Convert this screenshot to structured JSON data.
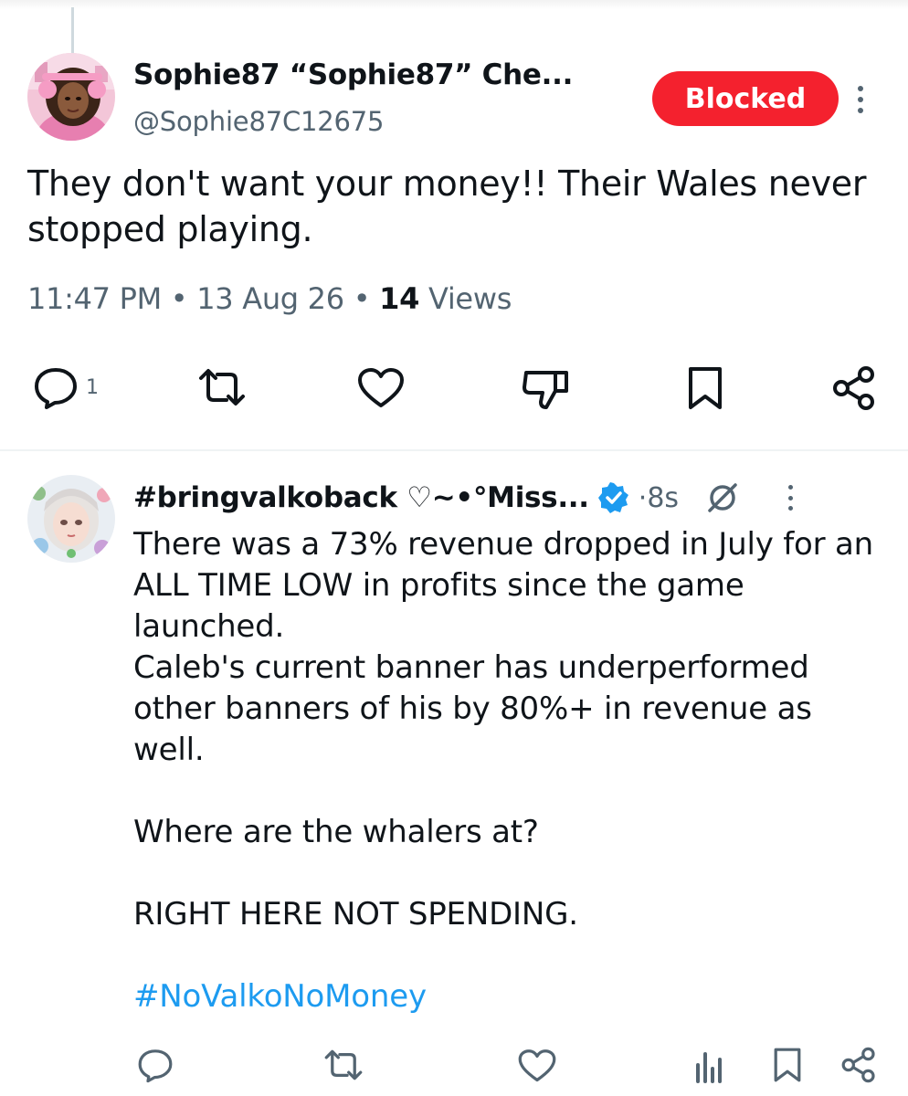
{
  "focused_tweet": {
    "display_name": "Sophie87 “Sophie87” Che...",
    "handle": "@Sophie87C12675",
    "block_button_label": "Blocked",
    "text": "They don't want your money!! Their Wales never stopped playing.",
    "time": "11:47 PM",
    "date": "13 Aug 26",
    "separator": "•",
    "views_count": "14",
    "views_label": "Views",
    "reply_count": "1",
    "actions": [
      "reply-icon",
      "retweet-icon",
      "like-icon",
      "dislike-icon",
      "bookmark-icon",
      "share-icon"
    ]
  },
  "reply_tweet": {
    "display_name": "#bringvalkoback ♡~•°Miss...",
    "time": "8s",
    "time_prefix": "·",
    "text_lines": [
      "There was a 73% revenue dropped in July for an ALL TIME LOW in profits since the game launched.",
      "Caleb's current banner has underperformed other banners of his by 80%+ in revenue as well.",
      "",
      "Where are the whalers at?",
      "",
      "RIGHT HERE NOT SPENDING.",
      ""
    ],
    "hashtag": "#NoValkoNoMoney",
    "actions": [
      "reply-icon",
      "retweet-icon",
      "like-icon",
      "views-icon",
      "bookmark-icon",
      "share-icon"
    ]
  },
  "colors": {
    "text": "#0f1419",
    "secondary": "#536471",
    "blocked_red": "#f4212e",
    "link_blue": "#1d9bf0",
    "divider": "#eff3f4"
  }
}
